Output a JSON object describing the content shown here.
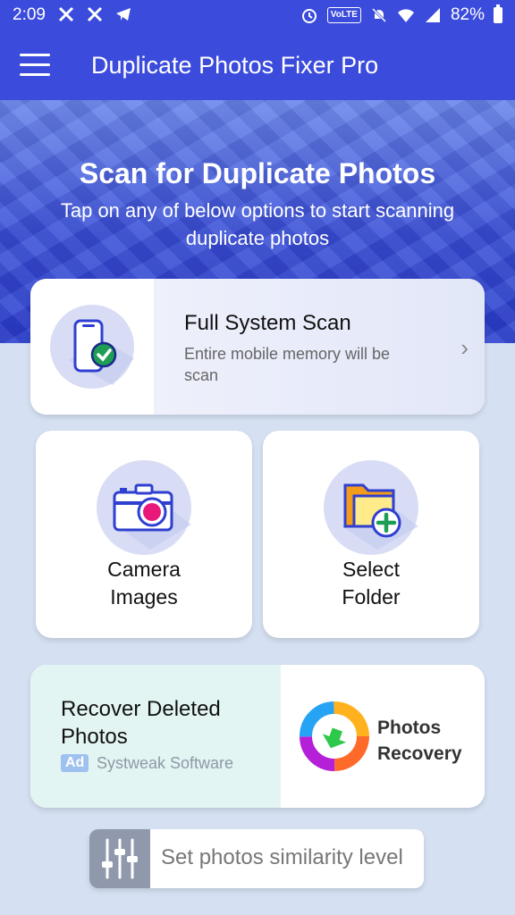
{
  "status_bar": {
    "time": "2:09",
    "notification_icons": [
      "x-icon",
      "x-icon",
      "telegram-icon"
    ],
    "volte": "VoLTE",
    "battery": "82%"
  },
  "app_bar": {
    "title": "Duplicate Photos Fixer Pro"
  },
  "hero": {
    "title": "Scan for Duplicate Photos",
    "subtitle": "Tap on any of below options to start scanning duplicate photos"
  },
  "full_scan": {
    "title": "Full System Scan",
    "description": "Entire mobile memory will be scan",
    "chevron": "›"
  },
  "options": [
    {
      "label_line1": "Camera",
      "label_line2": "Images",
      "icon": "camera-icon"
    },
    {
      "label_line1": "Select",
      "label_line2": "Folder",
      "icon": "folder-add-icon"
    }
  ],
  "ad": {
    "title_line1": "Recover Deleted",
    "title_line2": "Photos",
    "badge": "Ad",
    "sponsor": "Systweak Software",
    "product_line1": "Photos",
    "product_line2": "Recovery"
  },
  "similarity": {
    "label": "Set photos similarity level",
    "icon": "sliders-icon"
  },
  "colors": {
    "primary": "#3b4bdc",
    "background": "#d5e0f2",
    "ad_bg": "#e3f5f2",
    "check_green": "#1e9e55",
    "camera_pink": "#e8197a"
  }
}
